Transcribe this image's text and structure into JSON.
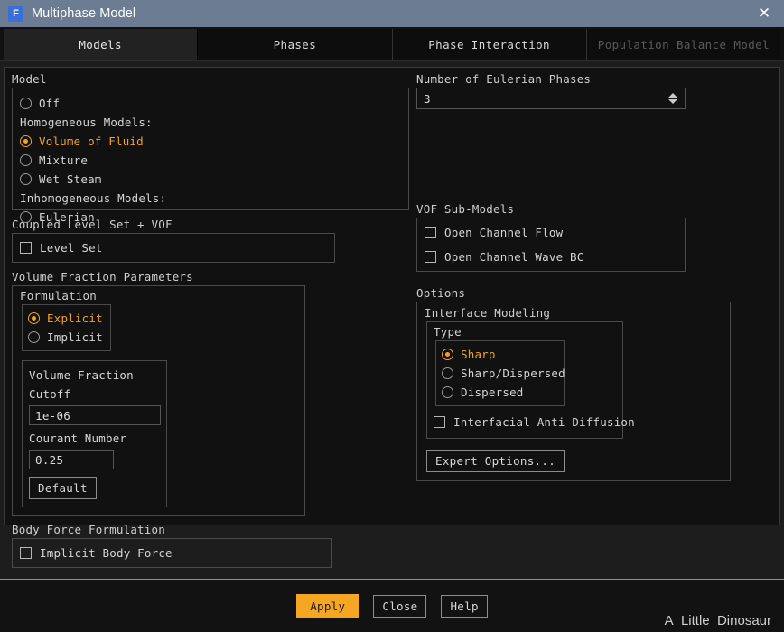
{
  "window": {
    "title": "Multiphase Model",
    "icon": "fluent-app-icon",
    "icon_letter": "F",
    "close_label": "✕"
  },
  "tabs": [
    {
      "label": "Models",
      "state": "active"
    },
    {
      "label": "Phases",
      "state": "normal"
    },
    {
      "label": "Phase Interaction",
      "state": "normal"
    },
    {
      "label": "Population Balance Model",
      "state": "disabled"
    }
  ],
  "model_group": {
    "title": "Model",
    "options": [
      {
        "kind": "radio",
        "label": "Off",
        "selected": false
      },
      {
        "kind": "label",
        "label": "Homogeneous Models:"
      },
      {
        "kind": "radio",
        "label": "Volume of Fluid",
        "selected": true
      },
      {
        "kind": "radio",
        "label": "Mixture",
        "selected": false
      },
      {
        "kind": "radio",
        "label": "Wet Steam",
        "selected": false
      },
      {
        "kind": "label",
        "label": "Inhomogeneous Models:"
      },
      {
        "kind": "radio",
        "label": "Eulerian",
        "selected": false
      }
    ]
  },
  "eulerian_phases": {
    "title": "Number of Eulerian Phases",
    "value": "3"
  },
  "coupled_level_set": {
    "title": "Coupled Level Set + VOF",
    "checkbox_label": "Level Set",
    "checked": false
  },
  "vof_submodels": {
    "title": "VOF Sub-Models",
    "items": [
      {
        "label": "Open Channel Flow",
        "checked": false
      },
      {
        "label": "Open Channel Wave BC",
        "checked": false
      }
    ]
  },
  "volume_fraction": {
    "title": "Volume Fraction Parameters",
    "formulation": {
      "title": "Formulation",
      "options": [
        {
          "label": "Explicit",
          "selected": true
        },
        {
          "label": "Implicit",
          "selected": false
        }
      ]
    },
    "cutoff_label": "Volume Fraction Cutoff",
    "cutoff_value": "1e-06",
    "courant_label": "Courant Number",
    "courant_value": "0.25",
    "default_button": "Default"
  },
  "options_group": {
    "title": "Options",
    "interface_modeling": {
      "title": "Interface Modeling",
      "type": {
        "title": "Type",
        "options": [
          {
            "label": "Sharp",
            "selected": true
          },
          {
            "label": "Sharp/Dispersed",
            "selected": false
          },
          {
            "label": "Dispersed",
            "selected": false
          }
        ]
      },
      "anti_diffusion": {
        "label": "Interfacial Anti-Diffusion",
        "checked": false
      }
    },
    "expert_button": "Expert Options..."
  },
  "body_force": {
    "title": "Body Force Formulation",
    "checkbox_label": "Implicit Body Force",
    "checked": false
  },
  "footer": {
    "apply": "Apply",
    "close": "Close",
    "help": "Help",
    "watermark": "A_Little_Dinosaur"
  },
  "colors": {
    "accent": "#f0a32a",
    "apply_bg": "#f5a623",
    "titlebar": "#6b7c93",
    "panel_bg": "#111111"
  }
}
